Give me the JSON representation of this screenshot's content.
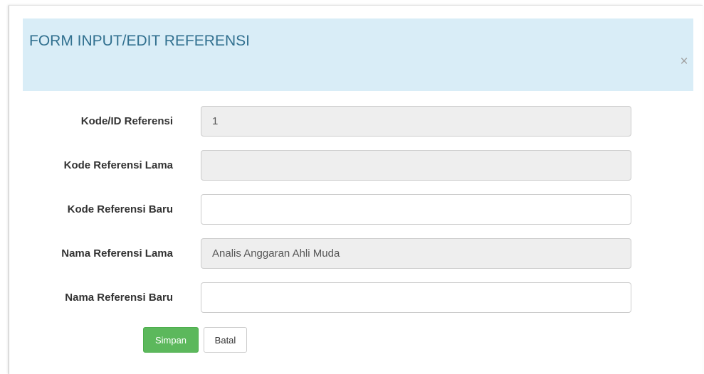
{
  "modal": {
    "title": "FORM INPUT/EDIT REFERENSI",
    "close_symbol": "×"
  },
  "form": {
    "fields": [
      {
        "label": "Kode/ID Referensi",
        "value": "1",
        "readonly": true
      },
      {
        "label": "Kode Referensi Lama",
        "value": "",
        "readonly": true
      },
      {
        "label": "Kode Referensi Baru",
        "value": "",
        "readonly": false
      },
      {
        "label": "Nama Referensi Lama",
        "value": "Analis Anggaran Ahli Muda",
        "readonly": true
      },
      {
        "label": "Nama Referensi Baru",
        "value": "",
        "readonly": false
      }
    ]
  },
  "buttons": {
    "save_label": "Simpan",
    "cancel_label": "Batal"
  },
  "colors": {
    "header_bg": "#d9edf7",
    "title_text": "#31708f",
    "save_button": "#5cb85c",
    "readonly_input_bg": "#eeeeee"
  },
  "icons": {
    "close": "close-icon"
  }
}
